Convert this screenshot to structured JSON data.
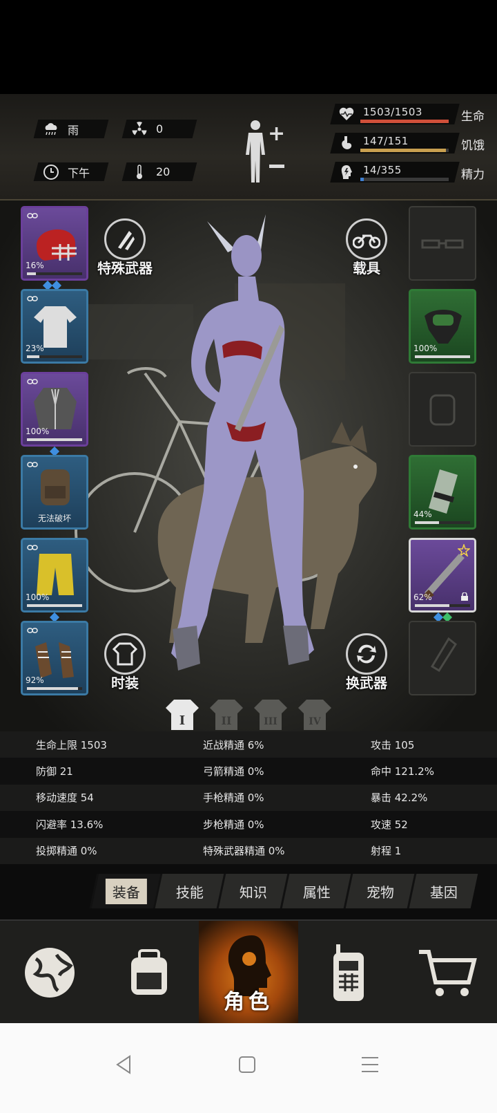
{
  "environment": {
    "weather": "雨",
    "radiation": "0",
    "time_of_day": "下午",
    "temperature": "20"
  },
  "vitals": [
    {
      "value": "1503/1503",
      "label": "生命",
      "fill": 1.0,
      "color": "#d0503a",
      "icon": "heart-icon"
    },
    {
      "value": "147/151",
      "label": "饥饿",
      "fill": 0.97,
      "color": "#c9a050",
      "icon": "stomach-icon"
    },
    {
      "value": "14/355",
      "label": "精力",
      "fill": 0.04,
      "color": "#3f7fd0",
      "icon": "energy-icon"
    }
  ],
  "left_slots": [
    {
      "name": "helmet",
      "rarity": "purple",
      "percent": "16%",
      "durability": 0.16,
      "gems": [
        "#3f8fe0",
        "#3f8fe0"
      ]
    },
    {
      "name": "shirt",
      "rarity": "blue",
      "percent": "23%",
      "durability": 0.23,
      "gems": []
    },
    {
      "name": "jacket",
      "rarity": "purple",
      "percent": "100%",
      "durability": 1.0,
      "gems": [
        "#3f8fe0"
      ]
    },
    {
      "name": "backpack",
      "rarity": "blue",
      "percent": "",
      "note": "无法破坏",
      "durability": 0,
      "gems": []
    },
    {
      "name": "pants",
      "rarity": "blue",
      "percent": "100%",
      "durability": 1.0,
      "gems": [
        "#3f8fe0"
      ]
    },
    {
      "name": "shoes",
      "rarity": "blue",
      "percent": "92%",
      "durability": 0.92,
      "gems": []
    }
  ],
  "right_slots": [
    {
      "name": "glasses",
      "rarity": "empty",
      "percent": ""
    },
    {
      "name": "gas-mask",
      "rarity": "green",
      "percent": "100%",
      "durability": 1.0
    },
    {
      "name": "accessory",
      "rarity": "empty",
      "percent": ""
    },
    {
      "name": "canister",
      "rarity": "green",
      "percent": "44%",
      "durability": 0.44
    },
    {
      "name": "machete",
      "rarity": "purple",
      "percent": "62%",
      "durability": 0.62,
      "gems": [
        "#3f8fe0",
        "#3fbf6a"
      ]
    },
    {
      "name": "throwable",
      "rarity": "empty",
      "percent": ""
    }
  ],
  "actions": {
    "special_weapon": "特殊武器",
    "vehicle": "载具",
    "fashion": "时装",
    "swap_weapon": "换武器"
  },
  "outfits": [
    "I",
    "II",
    "III",
    "IV"
  ],
  "stats": [
    [
      "生命上限 1503",
      "近战精通 6%",
      "攻击 105"
    ],
    [
      "防御 21",
      "弓箭精通 0%",
      "命中 121.2%"
    ],
    [
      "移动速度 54",
      "手枪精通 0%",
      "暴击 42.2%"
    ],
    [
      "闪避率 13.6%",
      "步枪精通 0%",
      "攻速 52"
    ],
    [
      "投掷精通 0%",
      "特殊武器精通 0%",
      "射程 1"
    ]
  ],
  "tabs": [
    "装备",
    "技能",
    "知识",
    "属性",
    "宠物",
    "基因"
  ],
  "active_tab": "装备",
  "nav": {
    "active_label": "角色"
  }
}
